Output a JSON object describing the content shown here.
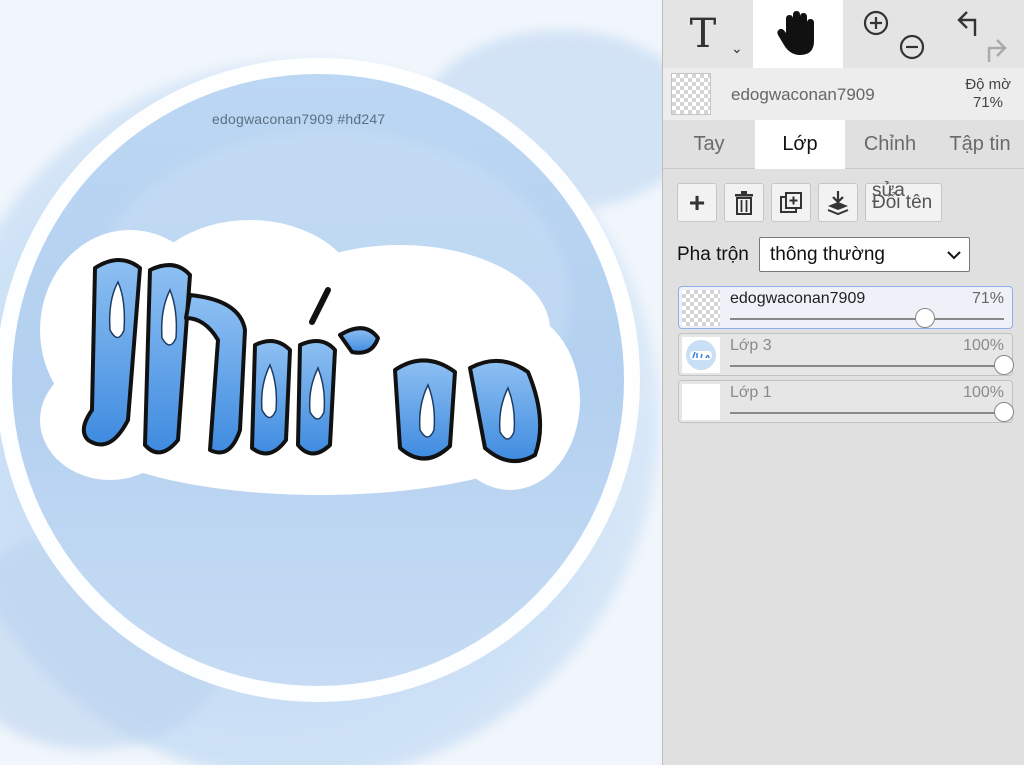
{
  "canvas": {
    "watermark": "edogwaconan7909   #hđ247",
    "artwork_text": "Hứa"
  },
  "toolbar": {
    "tools": [
      {
        "name": "text-tool",
        "label": "T"
      },
      {
        "name": "hand-tool",
        "label": "hand"
      },
      {
        "name": "zoom-tools",
        "label": "zoom"
      },
      {
        "name": "undo-redo",
        "label": "undo"
      }
    ]
  },
  "layer_info": {
    "name": "edogwaconan7909",
    "opacity_label": "Độ mờ",
    "opacity_value": "71%"
  },
  "tabs": [
    "Tay",
    "Lớp",
    "Chỉnh",
    "Tập tin"
  ],
  "active_tab": "Lớp",
  "layer_actions": {
    "add": "+",
    "rename_top": "sửa",
    "rename": "Đổi tên"
  },
  "blend": {
    "label": "Pha trộn",
    "value": "thông thường",
    "options": [
      "thông thường"
    ]
  },
  "layers": [
    {
      "name": "edogwaconan7909",
      "opacity": "71%",
      "opacity_fraction": 0.71,
      "selected": true
    },
    {
      "name": "Lớp 3",
      "opacity": "100%",
      "opacity_fraction": 1.0,
      "selected": false
    },
    {
      "name": "Lớp 1",
      "opacity": "100%",
      "opacity_fraction": 1.0,
      "selected": false
    }
  ],
  "colors": {
    "accent_blue": "#5a9de8",
    "panel_bg": "#e0e0e0",
    "selected_border": "#8fb0e8"
  }
}
